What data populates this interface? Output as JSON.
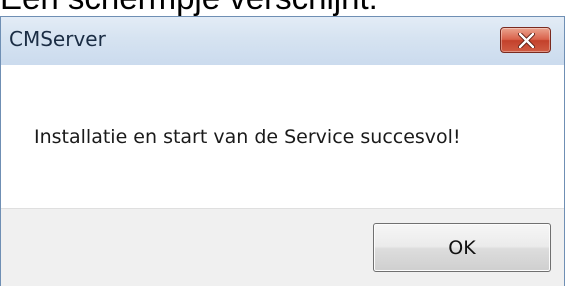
{
  "page": {
    "cropped_heading": "Een schermpje verschijnt:"
  },
  "dialog": {
    "title": "CMServer",
    "close_icon": "close-x-icon",
    "message": "Installatie en start van de Service succesvol!",
    "ok_label": "OK"
  },
  "colors": {
    "titlebar": "#d6e3f1",
    "close_button": "#d05c44",
    "button_area": "#f0f0f0"
  }
}
